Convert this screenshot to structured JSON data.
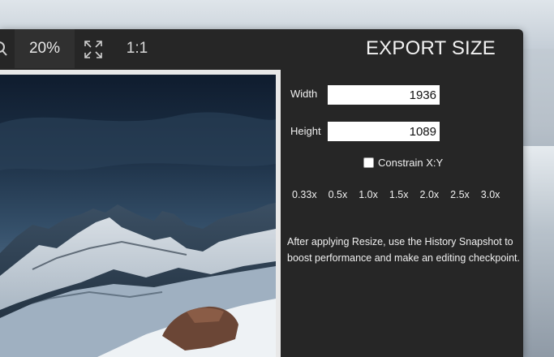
{
  "toolbar": {
    "zoom_icon": "magnifier-icon",
    "zoom_value": "20%",
    "fit_icon": "fit-to-screen-icon",
    "actual_size_label": "1:1"
  },
  "export": {
    "title": "EXPORT SIZE",
    "width_label": "Width",
    "width_value": "1936",
    "height_label": "Height",
    "height_value": "1089",
    "constrain_label": "Constrain X:Y",
    "constrain_checked": false,
    "scales": [
      "0.33x",
      "0.5x",
      "1.0x",
      "1.5x",
      "2.0x",
      "2.5x",
      "3.0x"
    ],
    "note": "After applying Resize, use the History Snapshot to boost performance and make an editing checkpoint."
  }
}
